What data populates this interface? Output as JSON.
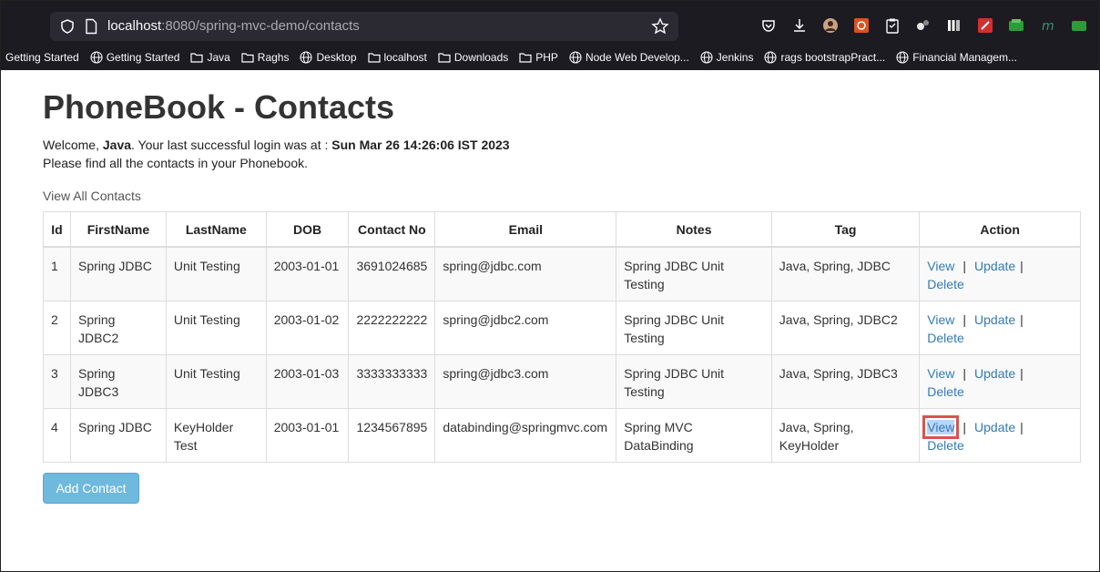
{
  "browser": {
    "url_host": "localhost",
    "url_rest": ":8080/spring-mvc-demo/contacts",
    "bookmarks": [
      {
        "label": "Getting Started",
        "icon": "none"
      },
      {
        "label": "Getting Started",
        "icon": "globe-icon"
      },
      {
        "label": "Java",
        "icon": "folder-icon"
      },
      {
        "label": "Raghs",
        "icon": "folder-icon"
      },
      {
        "label": "Desktop",
        "icon": "globe-icon"
      },
      {
        "label": "localhost",
        "icon": "folder-icon"
      },
      {
        "label": "Downloads",
        "icon": "folder-icon"
      },
      {
        "label": "PHP",
        "icon": "folder-icon"
      },
      {
        "label": "Node Web Develop...",
        "icon": "globe-icon"
      },
      {
        "label": "Jenkins",
        "icon": "globe-icon"
      },
      {
        "label": "rags bootstrapPract...",
        "icon": "globe-icon"
      },
      {
        "label": "Financial Managem...",
        "icon": "globe-icon"
      }
    ]
  },
  "page": {
    "title": "PhoneBook - Contacts",
    "welcome_prefix": "Welcome, ",
    "user": "Java",
    "welcome_mid": ". Your last successful login was at : ",
    "last_login": "Sun Mar 26 14:26:06 IST 2023",
    "subtitle": "Please find all the contacts in your Phonebook.",
    "view_all": "View All Contacts",
    "add_button": "Add Contact"
  },
  "table": {
    "headers": [
      "Id",
      "FirstName",
      "LastName",
      "DOB",
      "Contact No",
      "Email",
      "Notes",
      "Tag",
      "Action"
    ],
    "rows": [
      {
        "id": "1",
        "first": "Spring JDBC",
        "last": "Unit Testing",
        "dob": "2003-01-01",
        "phone": "3691024685",
        "email": "spring@jdbc.com",
        "notes": "Spring JDBC Unit Testing",
        "tag": "Java, Spring, JDBC"
      },
      {
        "id": "2",
        "first": "Spring JDBC2",
        "last": "Unit Testing",
        "dob": "2003-01-02",
        "phone": "2222222222",
        "email": "spring@jdbc2.com",
        "notes": "Spring JDBC Unit Testing",
        "tag": "Java, Spring, JDBC2"
      },
      {
        "id": "3",
        "first": "Spring JDBC3",
        "last": "Unit Testing",
        "dob": "2003-01-03",
        "phone": "3333333333",
        "email": "spring@jdbc3.com",
        "notes": "Spring JDBC Unit Testing",
        "tag": "Java, Spring, JDBC3"
      },
      {
        "id": "4",
        "first": "Spring JDBC",
        "last": "KeyHolder Test",
        "dob": "2003-01-01",
        "phone": "1234567895",
        "email": "databinding@springmvc.com",
        "notes": "Spring MVC DataBinding",
        "tag": "Java, Spring, KeyHolder"
      }
    ],
    "actions": {
      "view": "View",
      "update": "Update",
      "delete": "Delete",
      "separator": "|"
    }
  },
  "colors": {
    "link": "#337ab7",
    "button": "#6fb9de",
    "highlight_box": "#d9534f"
  }
}
